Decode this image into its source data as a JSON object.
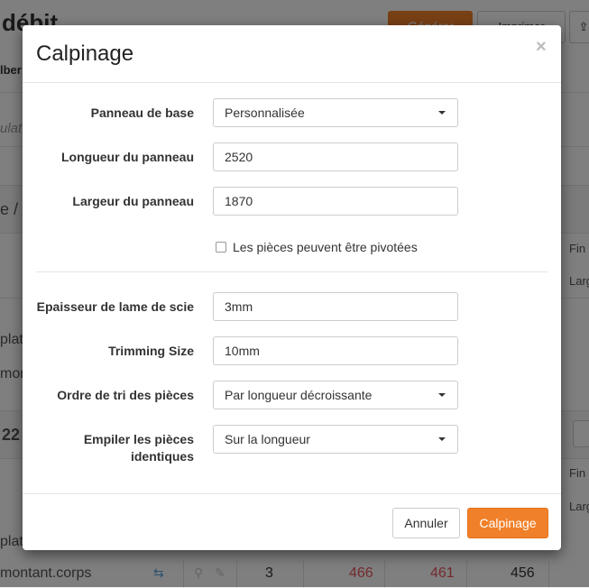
{
  "background": {
    "page_title": "débit",
    "confirm_label": "Générer",
    "print_label": "Imprimer",
    "sub_label": "lber",
    "calc_label": "ulat",
    "section_label": "e / 2",
    "row_text_1": "plat",
    "row_text_2": "mor",
    "section_label_2": "22",
    "row_text_3": "plat",
    "right_label_1": "Fin",
    "right_label_2": "Larg",
    "right_label_3": "Fin",
    "right_label_4": "Larg",
    "bottom_row": {
      "name": "montant.corps",
      "qty": "3",
      "val1": "466",
      "val2": "461",
      "val3": "456"
    }
  },
  "modal": {
    "title": "Calpinage",
    "close_symbol": "×",
    "fields": {
      "panneau_label": "Panneau de base",
      "panneau_value": "Personnalisée",
      "longueur_label": "Longueur du panneau",
      "longueur_value": "2520",
      "largeur_label": "Largeur du panneau",
      "largeur_value": "1870",
      "pivot_label": "Les pièces peuvent être pivotées",
      "pivot_checked": false,
      "epaisseur_label": "Epaisseur de lame de scie",
      "epaisseur_value": "3mm",
      "trimming_label": "Trimming Size",
      "trimming_value": "10mm",
      "ordre_label": "Ordre de tri des pièces",
      "ordre_value": "Par longueur décroissante",
      "empiler_label_line1": "Empiler les pièces",
      "empiler_label_line2": "identiques",
      "empiler_value": "Sur la longueur"
    },
    "footer": {
      "cancel_label": "Annuler",
      "submit_label": "Calpinage"
    }
  },
  "colors": {
    "accent": "#f0812a",
    "danger_text": "#e8555a"
  }
}
